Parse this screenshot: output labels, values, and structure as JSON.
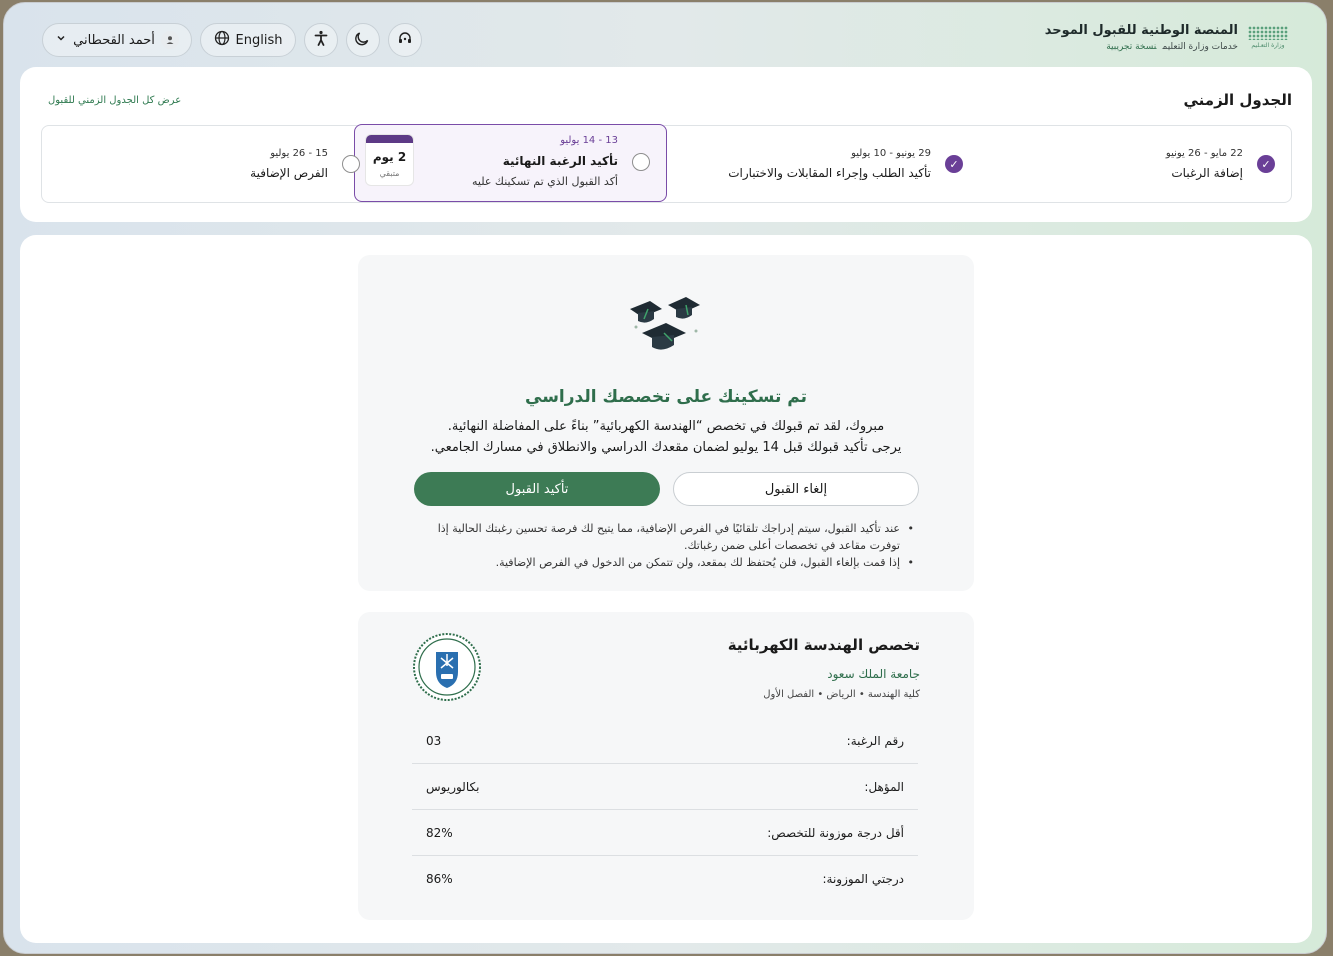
{
  "header": {
    "brand_title": "المنصة الوطنية للقبول الموحد",
    "brand_sub": "خدمات وزارة التعليم",
    "brand_trial": "نسخة تجريبية",
    "ministry_logo_text": "وزارة التعـليم",
    "user_name": "أحمد القحطاني",
    "language_label": "English"
  },
  "timeline": {
    "title": "الجدول الزمني",
    "view_all_link": "عرض كل الجدول الزمني للقبول",
    "steps": [
      {
        "date": "22 مايو - 26 يونيو",
        "name": "إضافة الرغبات",
        "status": "done"
      },
      {
        "date": "29 يونيو - 10 يوليو",
        "name": "تأكيد الطلب وإجراء المقابلات والاختبارات",
        "status": "done"
      },
      {
        "date": "13 - 14 يوليو",
        "name": "تأكيد الرغبة النهائية",
        "desc": "أكد القبول الذي تم تسكينك عليه",
        "status": "active",
        "remaining_value": "2 يوم",
        "remaining_label": "متبقي"
      },
      {
        "date": "15 - 26 يوليو",
        "name": "الفرص الإضافية",
        "status": "upcoming"
      }
    ]
  },
  "acceptance": {
    "title": "تم تسكينك على تخصصك الدراسي",
    "line1": "مبروك، لقد تم قبولك في تخصص “الهندسة الكهربائية” بناءً على المفاضلة النهائية.",
    "line2": "يرجى تأكيد قبولك قبل 14 يوليو لضمان مقعدك الدراسي والانطلاق في مسارك الجامعي.",
    "confirm_label": "تأكيد القبول",
    "cancel_label": "إلغاء القبول",
    "notes": [
      "عند تأكيد القبول، سيتم إدراجك تلقائيًا في الفرص الإضافية، مما يتيح لك فرصة تحسين رغبتك الحالية إذا توفرت مقاعد في تخصصات أعلى ضمن رغباتك.",
      "إذا قمت بإلغاء القبول، فلن يُحتفظ لك بمقعد، ولن تتمكن من الدخول في الفرص الإضافية."
    ]
  },
  "major": {
    "title": "تخصص الهندسة الكهربائية",
    "university": "جامعة الملك سعود",
    "meta": "كلية الهندسة • الرياض • الفصل الأول",
    "rows": [
      {
        "label": "رقم الرغبة:",
        "value": "03"
      },
      {
        "label": "المؤهل:",
        "value": "بكالوريوس"
      },
      {
        "label": "أقل درجة موزونة للتخصص:",
        "value": "82%"
      },
      {
        "label": "درجتي الموزونة:",
        "value": "86%"
      }
    ]
  },
  "colors": {
    "accent_green": "#2f6e4c",
    "button_green": "#3d7b55",
    "accent_purple": "#6a3f97"
  }
}
